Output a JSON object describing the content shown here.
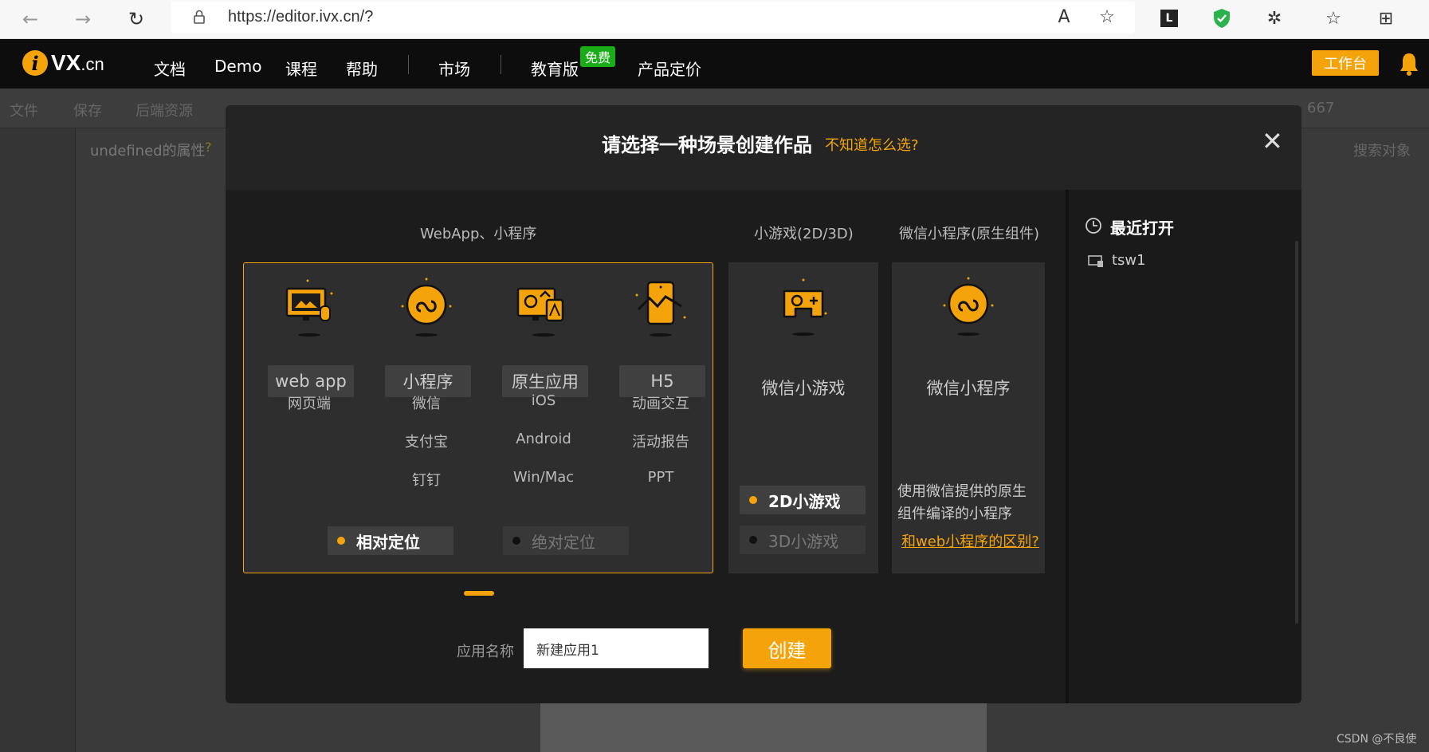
{
  "browser": {
    "url": "https://editor.ivx.cn/?"
  },
  "header": {
    "logo_text": "VX",
    "logo_suffix": ".cn",
    "menu": [
      "文档",
      "Demo",
      "课程",
      "帮助",
      "市场",
      "教育版",
      "产品定价"
    ],
    "free_badge": "免费",
    "workbench_label": "工作台"
  },
  "editor": {
    "toolbar": [
      "文件",
      "保存",
      "后端资源"
    ],
    "prop_title": "undefined的属性",
    "help_mark": "?",
    "search_obj": "搜索对象",
    "partial_text": "667"
  },
  "modal": {
    "title": "请选择一种场景创建作品",
    "help_link": "不知道怎么选?",
    "close": "✕",
    "col_webapp": "WebApp、小程序",
    "col_game": "小游戏(2D/3D)",
    "col_wxnative": "微信小程序(原生组件)",
    "apps": [
      {
        "label": "web app",
        "subs": [
          "网页端"
        ]
      },
      {
        "label": "小程序",
        "subs": [
          "微信",
          "支付宝",
          "钉钉"
        ]
      },
      {
        "label": "原生应用",
        "subs": [
          "iOS",
          "Android",
          "Win/Mac"
        ]
      },
      {
        "label": "H5",
        "subs": [
          "动画交互",
          "活动报告",
          "PPT"
        ]
      }
    ],
    "positioning": {
      "relative": "相对定位",
      "absolute": "绝对定位",
      "selected": "相对定位"
    },
    "game_card": {
      "name": "微信小游戏",
      "opt_2d": "2D小游戏",
      "opt_3d": "3D小游戏",
      "selected": "2D小游戏"
    },
    "wx_card": {
      "name": "微信小程序",
      "desc_line1": "使用微信提供的原生",
      "desc_line2": "组件编译的小程序",
      "diff_link": "和web小程序的区别?"
    },
    "app_name_label": "应用名称",
    "app_name_value": "新建应用1",
    "create_label": "创建",
    "recent_title": "最近打开",
    "recent_items": [
      "tsw1"
    ]
  },
  "watermark": "CSDN @不良使",
  "colors": {
    "accent": "#f5a30a",
    "green": "#1aad19",
    "modal_bg": "#1c1c1c"
  }
}
